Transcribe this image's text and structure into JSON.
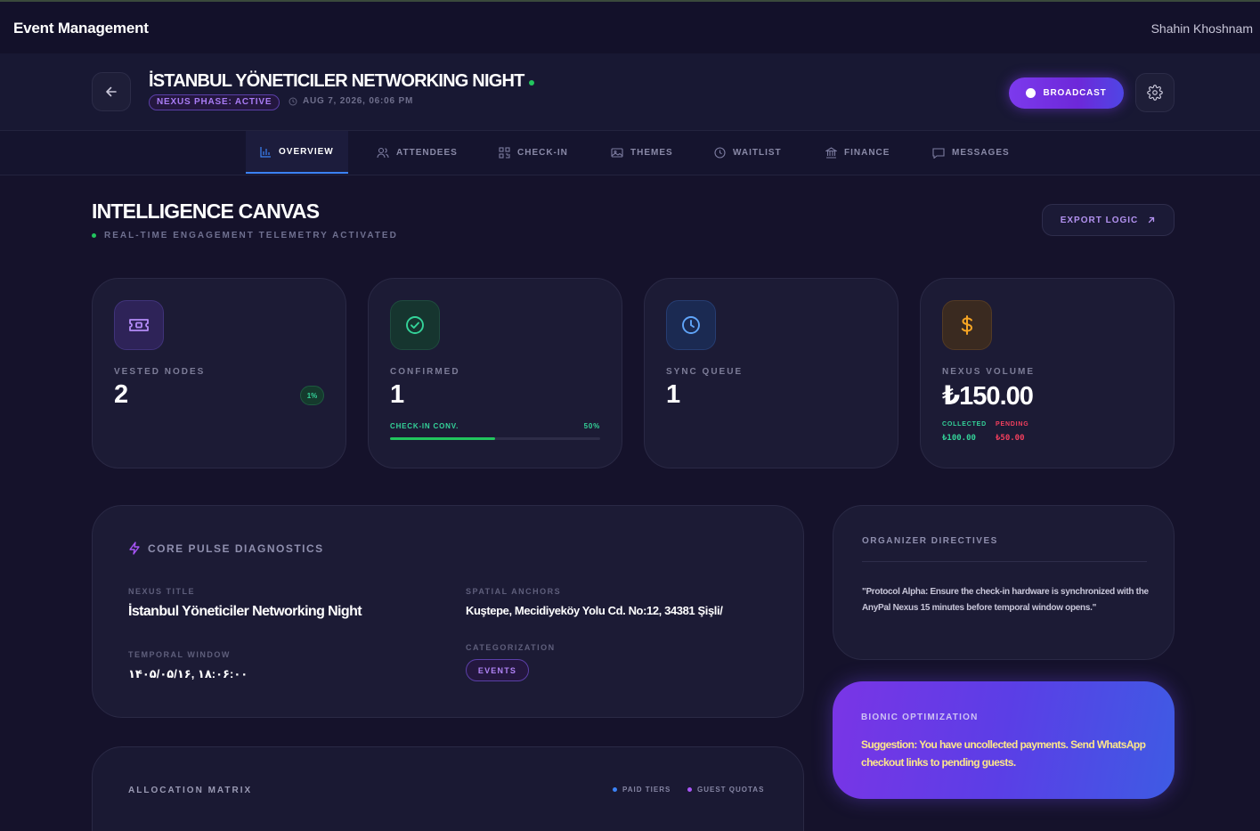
{
  "app": {
    "title": "Event Management",
    "user": "Shahin Khoshnam"
  },
  "event": {
    "title": "İSTANBUL YÖNETICILER NETWORKING NIGHT",
    "phase": "NEXUS PHASE: ACTIVE",
    "date": "AUG 7, 2026, 06:06 PM"
  },
  "header": {
    "broadcast_label": "BROADCAST"
  },
  "tabs": [
    {
      "label": "OVERVIEW",
      "icon": "bar-chart-icon",
      "active": true
    },
    {
      "label": "ATTENDEES",
      "icon": "users-icon"
    },
    {
      "label": "CHECK-IN",
      "icon": "qr-code-icon"
    },
    {
      "label": "THEMES",
      "icon": "image-icon"
    },
    {
      "label": "WAITLIST",
      "icon": "clock-icon"
    },
    {
      "label": "FINANCE",
      "icon": "bank-icon"
    },
    {
      "label": "MESSAGES",
      "icon": "message-icon"
    }
  ],
  "canvas": {
    "title": "INTELLIGENCE CANVAS",
    "subtitle": "REAL-TIME ENGAGEMENT TELEMETRY ACTIVATED",
    "export_label": "EXPORT LOGIC"
  },
  "stats": {
    "vested": {
      "label": "VESTED NODES",
      "value": "2",
      "pct": "1%",
      "icon": "ticket-icon"
    },
    "confirmed": {
      "label": "CONFIRMED",
      "value": "1",
      "conv_label": "CHECK-IN CONV.",
      "conv_pct": "50%",
      "conv_value": 0.5,
      "icon": "check-circle-icon"
    },
    "sync": {
      "label": "SYNC QUEUE",
      "value": "1",
      "icon": "clock-icon"
    },
    "volume": {
      "label": "NEXUS VOLUME",
      "value": "₺150.00",
      "collected_label": "COLLECTED",
      "collected": "₺100.00",
      "pending_label": "PENDING",
      "pending": "₺50.00",
      "icon": "dollar-icon"
    }
  },
  "diagnostics": {
    "title": "CORE PULSE DIAGNOSTICS",
    "nexus_title_label": "NEXUS TITLE",
    "nexus_title": "İstanbul Yöneticiler Networking Night",
    "temporal_label": "TEMPORAL WINDOW",
    "temporal": "۱۴۰۵/۰۵/۱۶, ۱۸:۰۶:۰۰",
    "spatial_label": "SPATIAL ANCHORS",
    "spatial": "Kuştepe, Mecidiyeköy Yolu Cd. No:12, 34381 Şişli/",
    "category_label": "CATEGORIZATION",
    "category": "EVENTS"
  },
  "directives": {
    "title": "ORGANIZER DIRECTIVES",
    "text": "\"Protocol Alpha: Ensure the check-in hardware is synchronized with the AnyPal Nexus 15 minutes before temporal window opens.\""
  },
  "bionic": {
    "title": "BIONIC OPTIMIZATION",
    "text": "Suggestion: You have uncollected payments. Send WhatsApp checkout links to pending guests."
  },
  "allocation": {
    "title": "ALLOCATION MATRIX",
    "legend_paid": "PAID TIERS",
    "legend_quota": "GUEST QUOTAS"
  },
  "colors": {
    "accent": "#7c3aed",
    "success": "#22c55e",
    "gold": "#f59e0b",
    "danger": "#f43f5e",
    "blue": "#3b82f6"
  }
}
